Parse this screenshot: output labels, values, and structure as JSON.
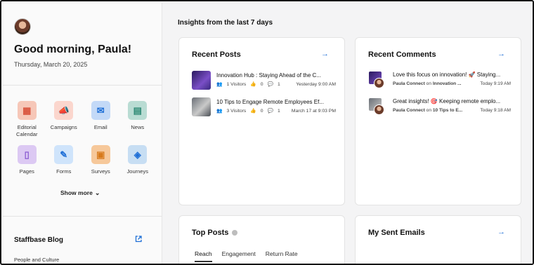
{
  "sidebar": {
    "greeting": "Good morning, Paula!",
    "date": "Thursday, March 20, 2025",
    "apps": [
      {
        "label": "Editorial Calendar",
        "icon": "calendar-icon",
        "glyph": "▦",
        "bg": "#f6c7b8",
        "fg": "#d9533d"
      },
      {
        "label": "Campaigns",
        "icon": "megaphone-icon",
        "glyph": "📣",
        "bg": "#fbd6cd",
        "fg": "#d8452f"
      },
      {
        "label": "Email",
        "icon": "email-icon",
        "glyph": "✉",
        "bg": "#c3d9f7",
        "fg": "#1f6fd6"
      },
      {
        "label": "News",
        "icon": "news-icon",
        "glyph": "▤",
        "bg": "#b9dcd3",
        "fg": "#2e8a75"
      },
      {
        "label": "Pages",
        "icon": "pages-icon",
        "glyph": "▯",
        "bg": "#dcc9f3",
        "fg": "#8a5bd1"
      },
      {
        "label": "Forms",
        "icon": "forms-icon",
        "glyph": "✎",
        "bg": "#cfe4fb",
        "fg": "#1f6fd6"
      },
      {
        "label": "Surveys",
        "icon": "clipboard-icon",
        "glyph": "▣",
        "bg": "#f6c89a",
        "fg": "#d77a1c"
      },
      {
        "label": "Journeys",
        "icon": "journeys-icon",
        "glyph": "◈",
        "bg": "#c7def3",
        "fg": "#1f6fd6"
      }
    ],
    "show_more": "Show more",
    "blog_title": "Staffbase Blog",
    "blog_category": "People and Culture"
  },
  "main": {
    "insights_label": "Insights from the last 7 days",
    "recent_posts": {
      "title": "Recent Posts",
      "items": [
        {
          "title": "Innovation Hub : Staying Ahead of the C...",
          "visitors": "1 Visitors",
          "likes": "0",
          "comments": "1",
          "time": "Yesterday 9:00 AM",
          "thumb": "#5a3fa0"
        },
        {
          "title": "10 Tips to Engage Remote Employees Ef...",
          "visitors": "3 Visitors",
          "likes": "0",
          "comments": "1",
          "time": "March 17 at 9:03 PM",
          "thumb": "#8a8f96"
        }
      ]
    },
    "recent_comments": {
      "title": "Recent Comments",
      "items": [
        {
          "text": "Love this focus on innovation! 🚀 Staying...",
          "author": "Paula Connect",
          "on": "on",
          "target": "Innovation ...",
          "time": "Today 9:19 AM"
        },
        {
          "text": "Great insights! 🎯 Keeping remote emplo...",
          "author": "Paula Connect",
          "on": "on",
          "target": "10 Tips to E...",
          "time": "Today 9:18 AM"
        }
      ]
    },
    "top_posts": {
      "title": "Top Posts",
      "tabs": [
        "Reach",
        "Engagement",
        "Return Rate"
      ]
    },
    "sent_emails": {
      "title": "My Sent Emails"
    }
  },
  "colors": {
    "accent": "#1f6fd6",
    "background": "#f4f4f5"
  }
}
